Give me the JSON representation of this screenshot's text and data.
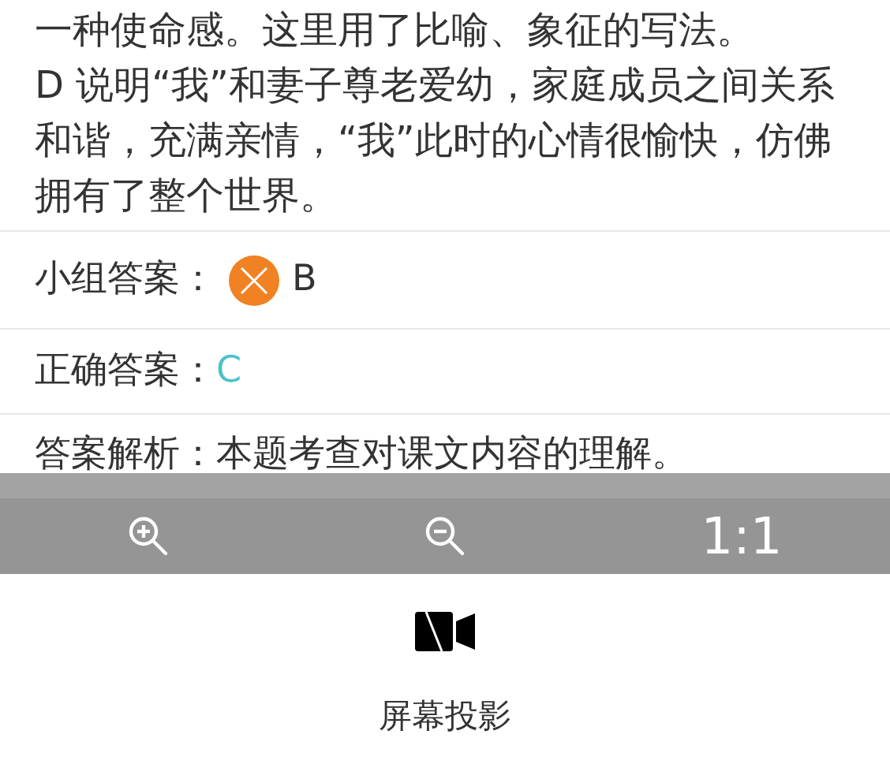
{
  "explanation": [
    "一种使命感。这里用了比喻、象征的写法。",
    "D 说明“我”和妻子尊老爱幼，家庭成员之间关系和谐，充满亲情，“我”此时的心情很愉快，仿佛拥有了整个世界。"
  ],
  "group_answer": {
    "label": "小组答案：",
    "value": "B",
    "correct": false
  },
  "correct_answer": {
    "label": "正确答案：",
    "value": "C"
  },
  "analysis": {
    "label": "答案解析：",
    "text": "本题考查对课文内容的理解。"
  },
  "toolbar": {
    "items": [
      {
        "kind": "zoom-in"
      },
      {
        "kind": "zoom-out"
      },
      {
        "kind": "text",
        "label": "1:1"
      }
    ]
  },
  "projection": {
    "label": "屏幕投影"
  }
}
